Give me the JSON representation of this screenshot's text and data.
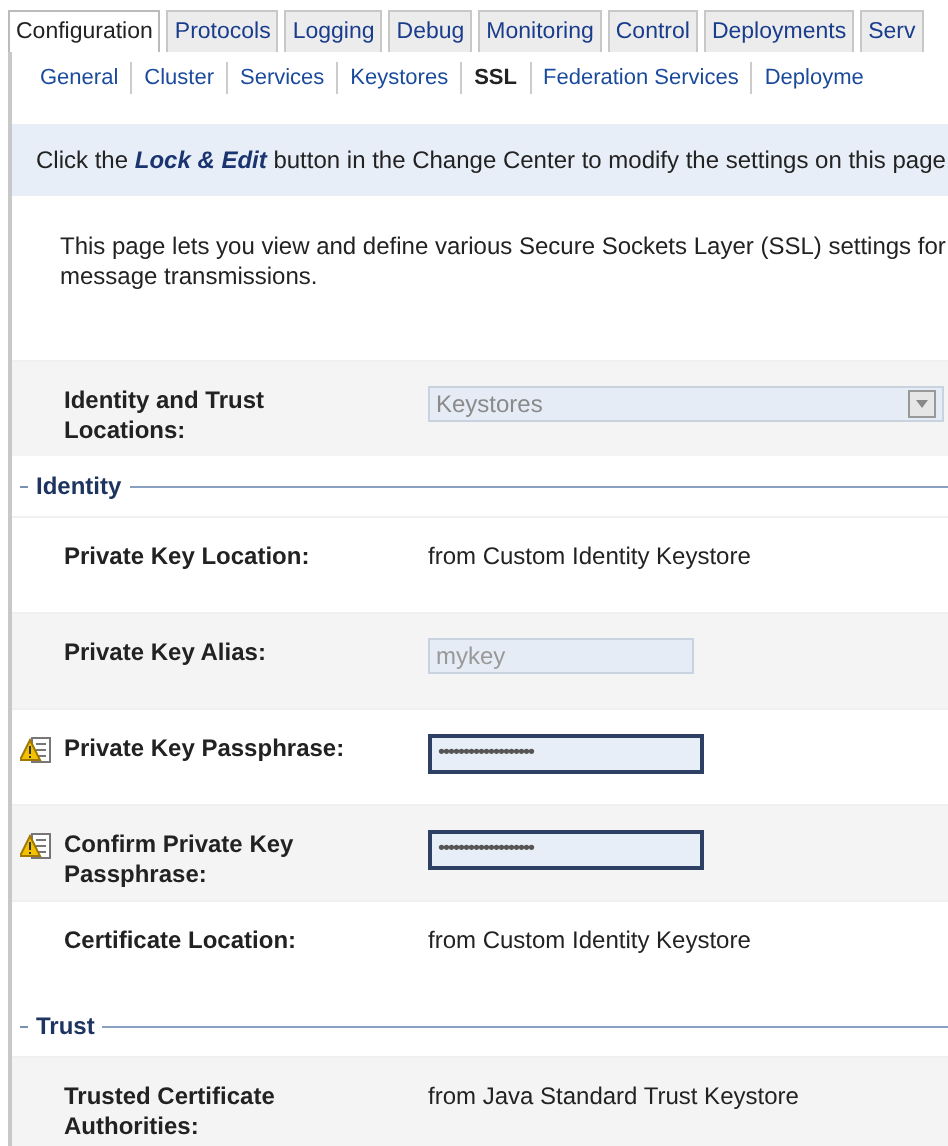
{
  "tabs": [
    {
      "label": "Configuration",
      "selected": true
    },
    {
      "label": "Protocols",
      "selected": false
    },
    {
      "label": "Logging",
      "selected": false
    },
    {
      "label": "Debug",
      "selected": false
    },
    {
      "label": "Monitoring",
      "selected": false
    },
    {
      "label": "Control",
      "selected": false
    },
    {
      "label": "Deployments",
      "selected": false
    },
    {
      "label": "Serv",
      "selected": false
    }
  ],
  "subtabs": [
    {
      "label": "General",
      "selected": false
    },
    {
      "label": "Cluster",
      "selected": false
    },
    {
      "label": "Services",
      "selected": false
    },
    {
      "label": "Keystores",
      "selected": false
    },
    {
      "label": "SSL",
      "selected": true
    },
    {
      "label": "Federation Services",
      "selected": false
    },
    {
      "label": "Deployme",
      "selected": false
    }
  ],
  "notice": "Click the **Lock & Edit** button in the Change Center to modify the settings on this page",
  "description": "This page lets you view and define various Secure Sockets Layer (SSL) settings for message transmissions.",
  "rows": [
    {
      "kind": "select",
      "label": "Identity and Trust Locations:",
      "value": "Keystores",
      "disabled": true
    },
    {
      "kind": "section",
      "label": "Identity"
    },
    {
      "kind": "text",
      "label": "Private Key Location:",
      "value": "from Custom Identity Keystore"
    },
    {
      "kind": "input",
      "label": "Private Key Alias:",
      "value": "mykey",
      "disabled": true
    },
    {
      "kind": "password",
      "label": "Private Key Passphrase:",
      "value": "•••••••••••••••••••",
      "disabled": false,
      "warning": true
    },
    {
      "kind": "password",
      "label": "Confirm Private Key Passphrase:",
      "value": "•••••••••••••••••••",
      "disabled": false,
      "warning": true
    },
    {
      "kind": "text",
      "label": "Certificate Location:",
      "value": "from Custom Identity Keystore"
    },
    {
      "kind": "section",
      "label": "Trust"
    },
    {
      "kind": "text",
      "label": "Trusted Certificate Authorities:",
      "value": "from Java Standard Trust Keystore"
    }
  ]
}
